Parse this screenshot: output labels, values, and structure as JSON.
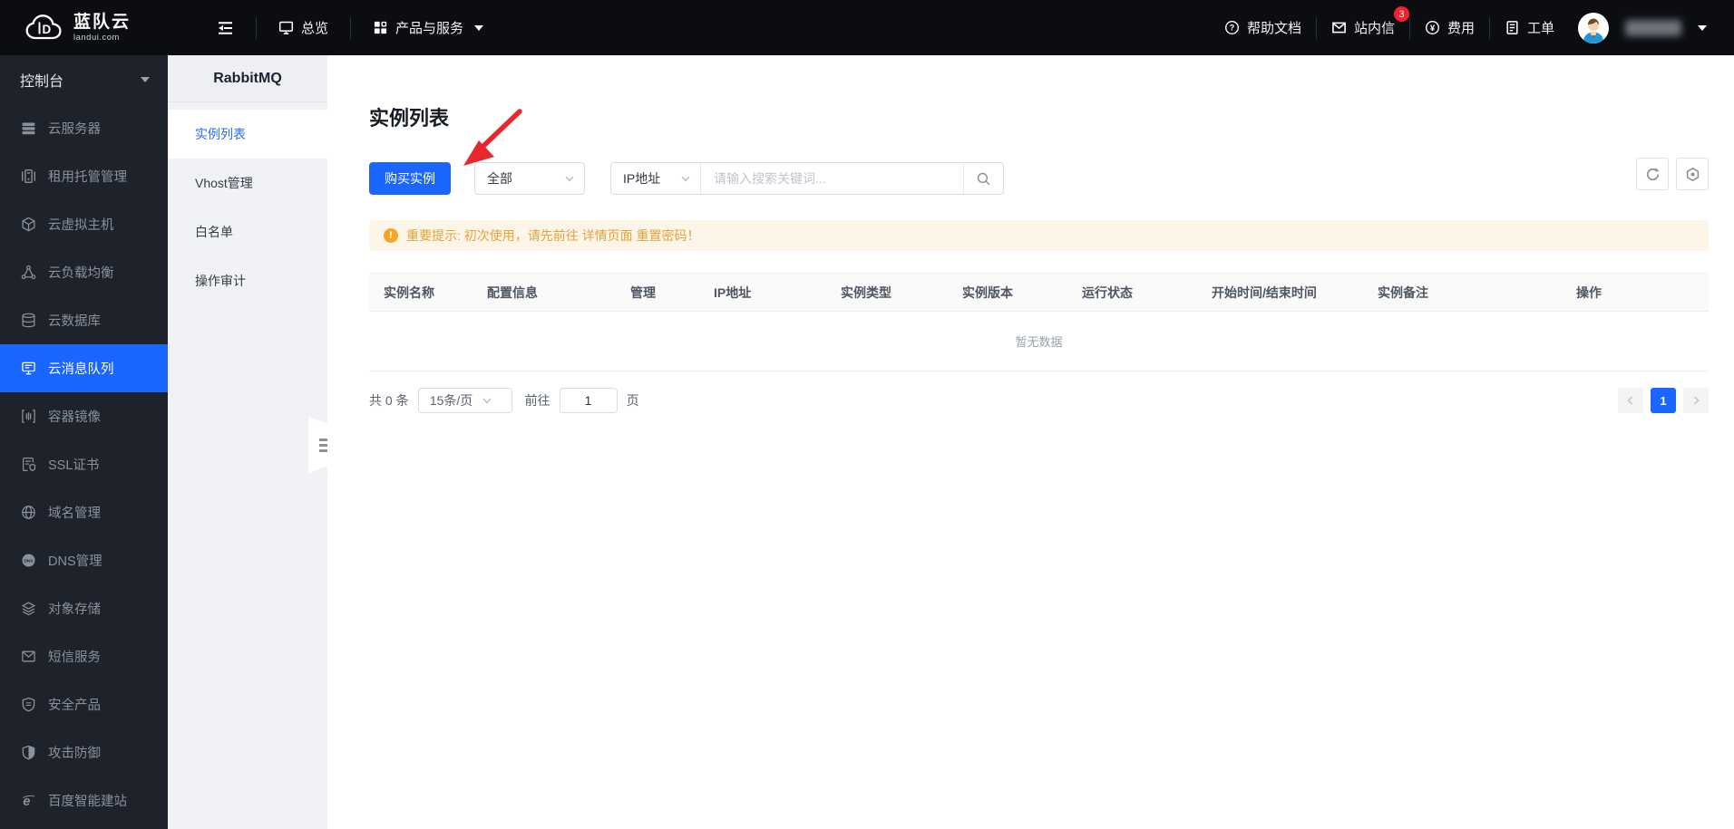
{
  "colors": {
    "accent": "#1a66ff",
    "warning_text": "#e6a23c",
    "warning_bg": "#fdf5e8",
    "badge": "#f5222d",
    "topbar_bg": "#0b0d11",
    "sidebar_bg": "#1e222a"
  },
  "topbar": {
    "logo": {
      "title": "蓝队云",
      "domain": "landui.com"
    },
    "overview": "总览",
    "products": "产品与服务",
    "help": "帮助文档",
    "messages": "站内信",
    "messages_badge": "3",
    "fees": "费用",
    "tickets": "工单"
  },
  "sidebar": {
    "console": "控制台",
    "items": [
      {
        "label": "云服务器"
      },
      {
        "label": "租用托管管理"
      },
      {
        "label": "云虚拟主机"
      },
      {
        "label": "云负载均衡"
      },
      {
        "label": "云数据库"
      },
      {
        "label": "云消息队列",
        "active": true
      },
      {
        "label": "容器镜像"
      },
      {
        "label": "SSL证书"
      },
      {
        "label": "域名管理"
      },
      {
        "label": "DNS管理"
      },
      {
        "label": "对象存储"
      },
      {
        "label": "短信服务"
      },
      {
        "label": "安全产品"
      },
      {
        "label": "攻击防御"
      },
      {
        "label": "百度智能建站"
      }
    ]
  },
  "submenu": {
    "title": "RabbitMQ",
    "items": [
      {
        "label": "实例列表",
        "active": true
      },
      {
        "label": "Vhost管理"
      },
      {
        "label": "白名单"
      },
      {
        "label": "操作审计"
      }
    ]
  },
  "main": {
    "title": "实例列表",
    "buy_button": "购买实例",
    "filter_all": "全部",
    "filter_field": "IP地址",
    "search_placeholder": "请输入搜索关键词...",
    "notice": "重要提示: 初次使用，请先前往 详情页面 重置密码！",
    "table": {
      "columns": [
        "实例名称",
        "配置信息",
        "管理",
        "IP地址",
        "实例类型",
        "实例版本",
        "运行状态",
        "开始时间/结束时间",
        "实例备注",
        "操作"
      ],
      "empty": "暂无数据"
    },
    "pagination": {
      "total": "共 0 条",
      "page_size": "15条/页",
      "goto_label": "前往",
      "page_value": "1",
      "page_unit": "页",
      "current_page": "1"
    }
  }
}
